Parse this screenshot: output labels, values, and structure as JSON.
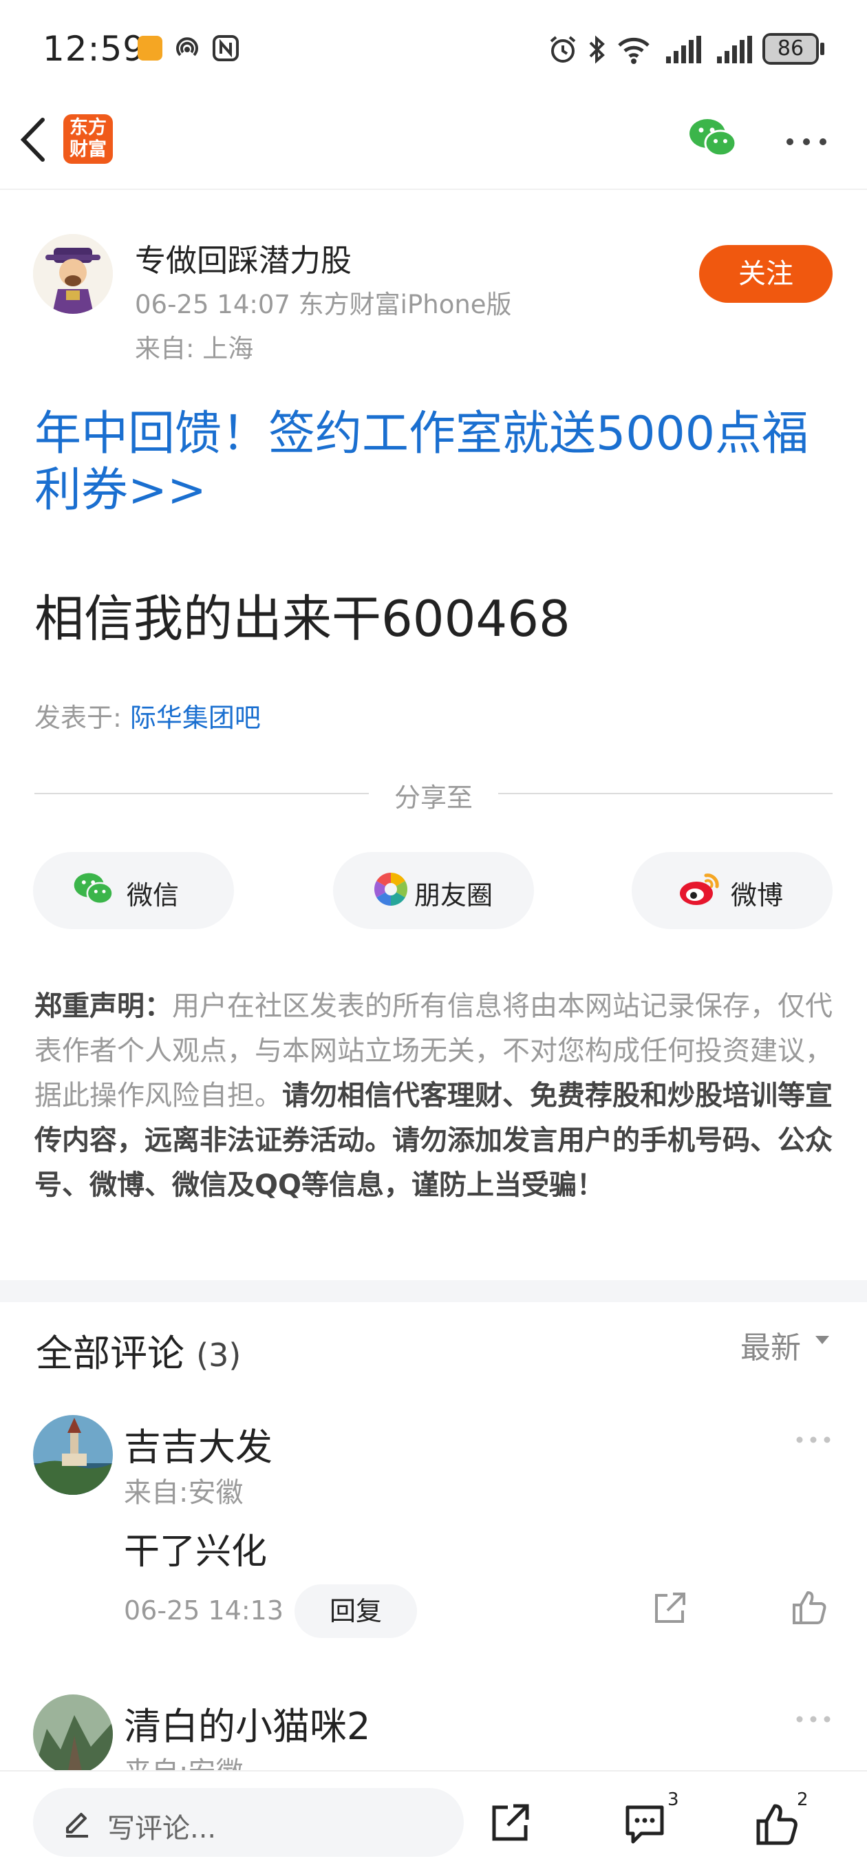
{
  "status_bar": {
    "time": "12:59",
    "battery": "86"
  },
  "nav": {
    "logo_text_line1": "东方",
    "logo_text_line2": "财富"
  },
  "post": {
    "author": "专做回踩潜力股",
    "meta": "06-25 14:07 东方财富iPhone版",
    "location": "来自: 上海",
    "follow_label": "关注",
    "promo_link": "年中回馈！签约工作室就送5000点福利券>>",
    "body": "相信我的出来干600468",
    "posted_in_label": "发表于: ",
    "posted_in_link": "际华集团吧"
  },
  "share": {
    "title": "分享至",
    "buttons": [
      {
        "label": "微信",
        "icon": "wechat-icon"
      },
      {
        "label": "朋友圈",
        "icon": "moments-icon"
      },
      {
        "label": "微博",
        "icon": "weibo-icon"
      }
    ]
  },
  "disclaimer": {
    "heading": "郑重声明：",
    "normal": "用户在社区发表的所有信息将由本网站记录保存，仅代表作者个人观点，与本网站立场无关，不对您构成任何投资建议，据此操作风险自担。",
    "bold": "请勿相信代客理财、免费荐股和炒股培训等宣传内容，远离非法证券活动。请勿添加发言用户的手机号码、公众号、微博、微信及QQ等信息，谨防上当受骗！"
  },
  "comments": {
    "title": "全部评论",
    "count": "(3)",
    "sort": "最新",
    "items": [
      {
        "name": "吉吉大发",
        "location": "来自:安徽",
        "text": "干了兴化",
        "time": "06-25 14:13",
        "reply_label": "回复"
      },
      {
        "name": "清白的小猫咪2",
        "location": "来自:安徽"
      }
    ]
  },
  "bottom_bar": {
    "input_placeholder": "写评论...",
    "comment_count": "3",
    "like_count": "2"
  },
  "colors": {
    "accent": "#f0580f",
    "link": "#1a6fd0"
  }
}
